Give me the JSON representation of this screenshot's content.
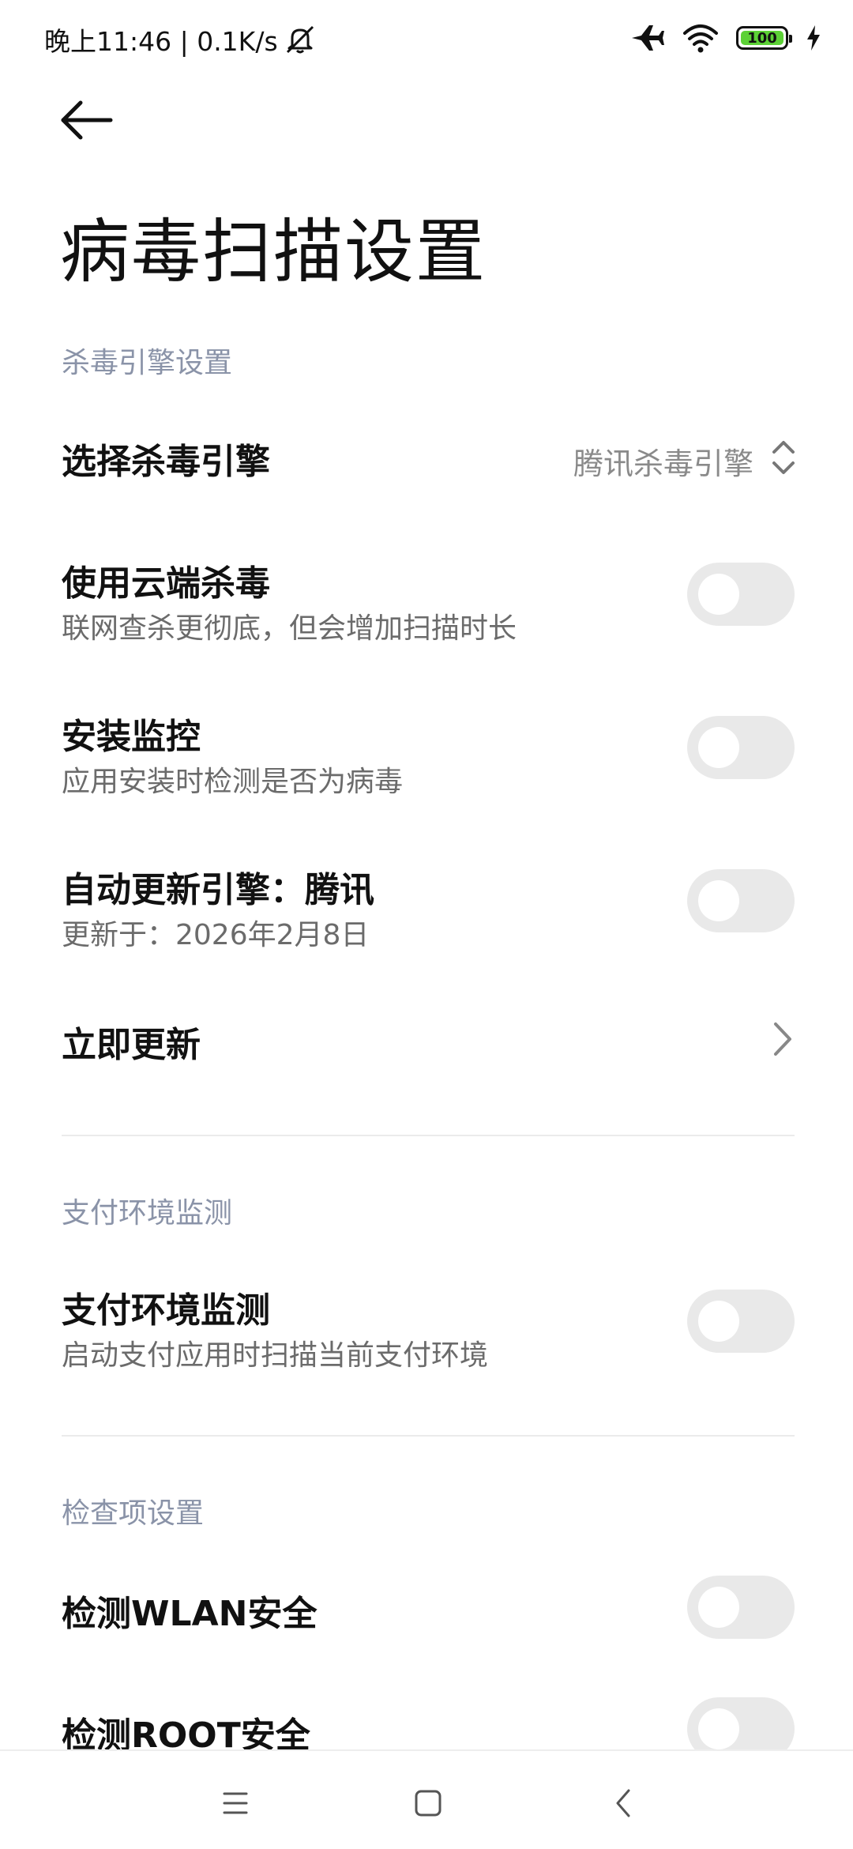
{
  "status_bar": {
    "time_speed": "晚上11:46 | 0.1K/s",
    "battery": "100"
  },
  "header": {
    "title": "病毒扫描设置"
  },
  "sections": {
    "engine": {
      "label": "杀毒引擎设置",
      "select_engine": {
        "title": "选择杀毒引擎",
        "value": "腾讯杀毒引擎"
      },
      "cloud": {
        "title": "使用云端杀毒",
        "subtitle": "联网查杀更彻底，但会增加扫描时长",
        "enabled": false
      },
      "install_monitor": {
        "title": "安装监控",
        "subtitle": "应用安装时检测是否为病毒",
        "enabled": false
      },
      "auto_update": {
        "title": "自动更新引擎：腾讯",
        "subtitle": "更新于：2026年2月8日",
        "enabled": false
      },
      "update_now": {
        "title": "立即更新"
      }
    },
    "payment": {
      "label": "支付环境监测",
      "monitor": {
        "title": "支付环境监测",
        "subtitle": "启动支付应用时扫描当前支付环境",
        "enabled": false
      }
    },
    "checks": {
      "label": "检查项设置",
      "wlan": {
        "title": "检测WLAN安全",
        "enabled": false
      },
      "root": {
        "title": "检测ROOT安全",
        "enabled": false
      }
    }
  },
  "icons": {
    "back": "arrow-left-icon",
    "mute": "bell-off-icon",
    "airplane": "airplane-icon",
    "wifi": "wifi-icon",
    "charging": "bolt-icon",
    "select": "up-down-arrows-icon",
    "chevron": "chevron-right-icon",
    "nav_menu": "menu-icon",
    "nav_home": "home-square-icon",
    "nav_back": "nav-back-icon"
  },
  "colors": {
    "battery_fill": "#5cd136",
    "section_label": "#8a93a8",
    "toggle_off": "#e9e9e9"
  }
}
